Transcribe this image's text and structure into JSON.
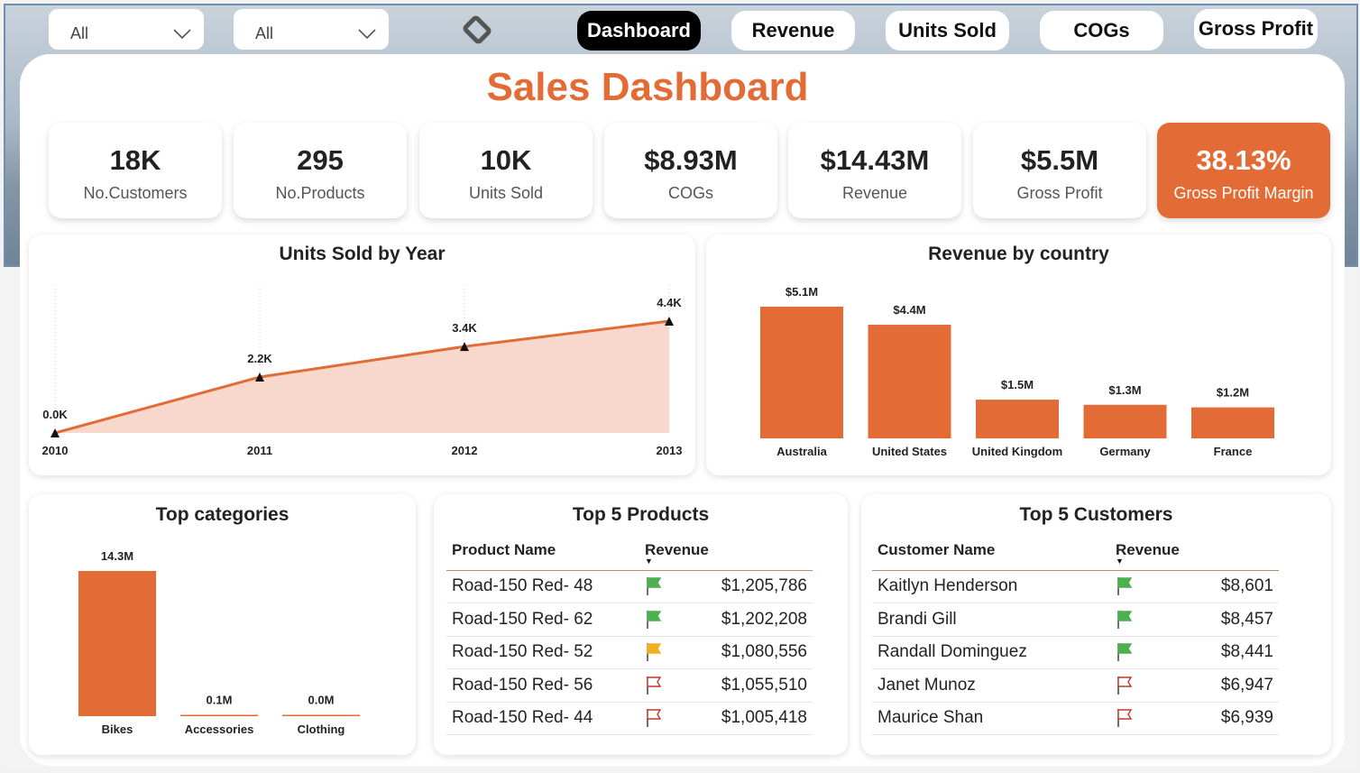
{
  "filters": [
    {
      "value": "All"
    },
    {
      "value": "All"
    }
  ],
  "nav": [
    {
      "label": "Dashboard",
      "active": true
    },
    {
      "label": "Revenue",
      "active": false
    },
    {
      "label": "Units Sold",
      "active": false
    },
    {
      "label": "COGs",
      "active": false
    },
    {
      "label": "Gross Profit",
      "active": false
    }
  ],
  "title": "Sales Dashboard",
  "colors": {
    "accent": "#e36c36",
    "area_fill": "#f8d8cc",
    "flag_green": "#4caf50",
    "flag_yellow": "#f2b01e",
    "flag_red": "#c0392b"
  },
  "kpis": [
    {
      "value": "18K",
      "label": "No.Customers"
    },
    {
      "value": "295",
      "label": "No.Products"
    },
    {
      "value": "10K",
      "label": "Units Sold"
    },
    {
      "value": "$8.93M",
      "label": "COGs"
    },
    {
      "value": "$14.43M",
      "label": "Revenue"
    },
    {
      "value": "$5.5M",
      "label": "Gross Profit"
    },
    {
      "value": "38.13%",
      "label": "Gross Profit Margin",
      "highlight": true
    }
  ],
  "units_by_year": {
    "title": "Units Sold by Year"
  },
  "revenue_by_country": {
    "title": "Revenue by country"
  },
  "top_categories": {
    "title": "Top categories"
  },
  "chart_data": [
    {
      "type": "area",
      "title": "Units Sold by Year",
      "x": [
        "2010",
        "2011",
        "2012",
        "2013"
      ],
      "values": [
        0,
        2.2,
        3.4,
        4.4
      ],
      "labels": [
        "0.0K",
        "2.2K",
        "3.4K",
        "4.4K"
      ],
      "unit": "K",
      "ylim": [
        0,
        4.4
      ],
      "grid": "vertical-dotted"
    },
    {
      "type": "bar",
      "title": "Revenue by country",
      "categories": [
        "Australia",
        "United States",
        "United Kingdom",
        "Germany",
        "France"
      ],
      "values": [
        5.1,
        4.4,
        1.5,
        1.3,
        1.2
      ],
      "labels": [
        "$5.1M",
        "$4.4M",
        "$1.5M",
        "$1.3M",
        "$1.2M"
      ],
      "unit": "$M"
    },
    {
      "type": "bar",
      "title": "Top categories",
      "categories": [
        "Bikes",
        "Accessories",
        "Clothing"
      ],
      "values": [
        14.3,
        0.1,
        0.0
      ],
      "labels": [
        "14.3M",
        "0.1M",
        "0.0M"
      ],
      "unit": "M"
    }
  ],
  "top_products": {
    "title": "Top 5 Products",
    "columns": [
      "Product Name",
      "Revenue"
    ],
    "rows": [
      {
        "name": "Road-150 Red- 48",
        "flag": "green",
        "revenue": "$1,205,786"
      },
      {
        "name": "Road-150 Red- 62",
        "flag": "green",
        "revenue": "$1,202,208"
      },
      {
        "name": "Road-150 Red- 52",
        "flag": "yellow",
        "revenue": "$1,080,556"
      },
      {
        "name": "Road-150 Red- 56",
        "flag": "red",
        "revenue": "$1,055,510"
      },
      {
        "name": "Road-150 Red- 44",
        "flag": "red",
        "revenue": "$1,005,418"
      }
    ]
  },
  "top_customers": {
    "title": "Top 5 Customers",
    "columns": [
      "Customer Name",
      "Revenue"
    ],
    "rows": [
      {
        "name": "Kaitlyn Henderson",
        "flag": "green",
        "revenue": "$8,601"
      },
      {
        "name": "Brandi Gill",
        "flag": "green",
        "revenue": "$8,457"
      },
      {
        "name": "Randall Dominguez",
        "flag": "green",
        "revenue": "$8,441"
      },
      {
        "name": "Janet Munoz",
        "flag": "red",
        "revenue": "$6,947"
      },
      {
        "name": "Maurice Shan",
        "flag": "red",
        "revenue": "$6,939"
      }
    ]
  }
}
